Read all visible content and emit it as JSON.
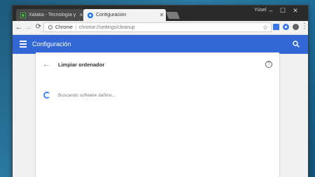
{
  "browser": {
    "tabs": [
      {
        "title": "Xataka - Tecnología y ga",
        "active": false
      },
      {
        "title": "Configuración",
        "active": true
      }
    ],
    "user_label": "Yúsel",
    "address_chip": "Chrome",
    "url": "chrome://settings/cleanup"
  },
  "app_header": {
    "title": "Configuración"
  },
  "card": {
    "title": "Limpiar ordenador",
    "status_text": "Buscando software dañino..."
  },
  "colors": {
    "accent": "#3367d6",
    "spinner": "#4285f4",
    "desktop": "#1e5a7c"
  },
  "icons": [
    "back-icon",
    "forward-icon",
    "reload-icon",
    "star-icon",
    "menu-icon",
    "search-icon",
    "help-icon",
    "spinner-icon"
  ]
}
